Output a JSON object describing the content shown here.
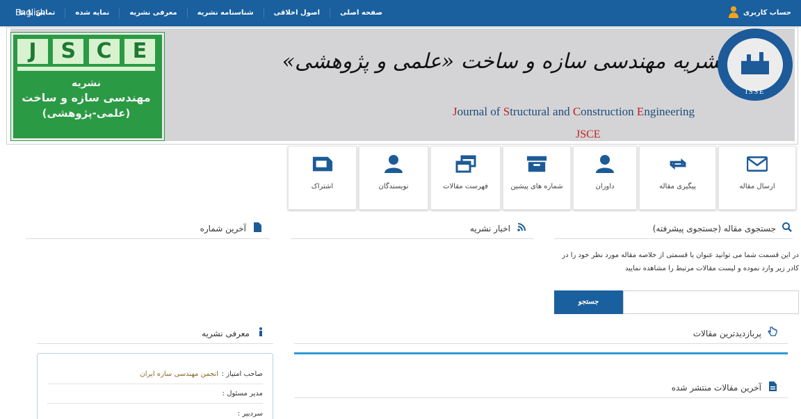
{
  "nav": {
    "english": "English",
    "items": [
      "صفحه اصلی",
      "اصول اخلاقی",
      "شناسنامه نشریه",
      "معرفی نشریه",
      "نمایه شده",
      "تماس با ما"
    ],
    "account": "حساب کاربری"
  },
  "banner": {
    "jsce_letters": [
      "J",
      "S",
      "C",
      "E"
    ],
    "jsce_line1": "نشریه",
    "jsce_line2": "مهندسی سازه و ساخت",
    "jsce_line3": "(علمی-پژوهشی)",
    "title_fa": "نشریه مهندسی سازه و ساخت «علمی و پژوهشی»",
    "title_en_parts": [
      {
        "text": "J",
        "red": true
      },
      {
        "text": "ournal of ",
        "red": false
      },
      {
        "text": "S",
        "red": true
      },
      {
        "text": "tructural and ",
        "red": false
      },
      {
        "text": "C",
        "red": true
      },
      {
        "text": "onstruction ",
        "red": false
      },
      {
        "text": "E",
        "red": true
      },
      {
        "text": "ngineering",
        "red": false
      }
    ],
    "abbr": "JSCE",
    "logo_label": "ISSE"
  },
  "tiles": [
    {
      "label": "ارسال مقاله",
      "icon": "envelope-icon"
    },
    {
      "label": "پیگیری مقاله",
      "icon": "retweet-arrows-icon"
    },
    {
      "label": "داوران",
      "icon": "user-icon"
    },
    {
      "label": "شماره های پیشین",
      "icon": "archive-box-icon"
    },
    {
      "label": "فهرست مقالات",
      "icon": "overlapping-windows-icon"
    },
    {
      "label": "نویسندگان",
      "icon": "user-icon"
    },
    {
      "label": "اشتراک",
      "icon": "folder-icon"
    }
  ],
  "sections": {
    "search_title": "جستجوی مقاله (جستجوی پیشرفته)",
    "news_title": "اخبار نشریه",
    "latest_issue_title": "آخرین شماره",
    "intro_title": "معرفی نشریه",
    "most_viewed_title": "پربازدیدترین مقالات",
    "latest_articles_title": "آخرین مقالات منتشر شده"
  },
  "search": {
    "description": "در این قسمت شما می توانید عنوان یا قسمتی از خلاصه مقاله مورد نظر خود را در کادر زیر وارد نموده و لیست مقالات مرتبط را مشاهده نمایید",
    "button": "جستجو",
    "value": ""
  },
  "intro": {
    "rows": [
      {
        "key": "صاحب امتیاز :",
        "value": "انجمن مهندسی سازه ایران"
      },
      {
        "key": "مدیر مسئول :",
        "value": ""
      },
      {
        "key": "سردبیر :",
        "value": ""
      }
    ]
  },
  "colors": {
    "primary": "#1a5f9e",
    "accent": "#2e9ad6",
    "account_icon": "#f3a21b",
    "jsce_green": "#2a9a44"
  }
}
